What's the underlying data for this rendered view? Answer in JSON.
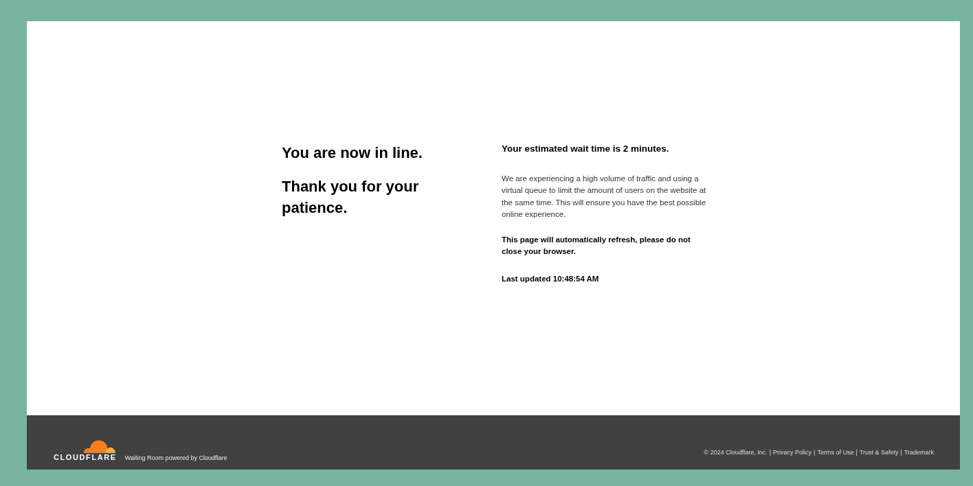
{
  "headings": [
    "You are now in line.",
    "Thank you for your patience."
  ],
  "wait_time": "Your estimated wait time is 2 minutes.",
  "message": "We are experiencing a high volume of traffic and using a virtual queue to limit the amount of users on the website at the same time. This will ensure you have the best possible online experience.",
  "refresh_notice": "This page will automatically refresh, please do not close your browser.",
  "last_updated": "Last updated 10:48:54 AM",
  "footer": {
    "logo_text": "CLOUDFLARE",
    "tagline": "Waiting Room powered by Cloudflare",
    "copyright": "© 2024 Cloudflare, Inc.",
    "separator": "|",
    "links": [
      "Privacy Policy",
      "Terms of Use",
      "Trust & Safety",
      "Trademark"
    ]
  }
}
